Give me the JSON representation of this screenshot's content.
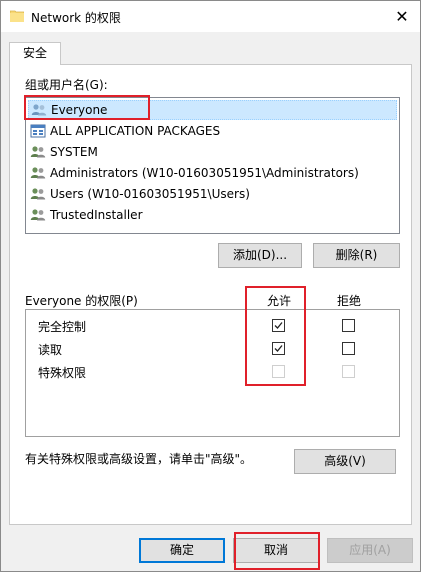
{
  "window": {
    "title": "Network 的权限",
    "close_glyph": "✕"
  },
  "tabs": [
    {
      "label": "安全"
    }
  ],
  "group": {
    "label": "组或用户名(G):",
    "items": [
      {
        "label": "Everyone",
        "icon": "users-icon",
        "selected": true
      },
      {
        "label": "ALL APPLICATION PACKAGES",
        "icon": "app-packages-icon"
      },
      {
        "label": "SYSTEM",
        "icon": "users-icon"
      },
      {
        "label": "Administrators (W10-01603051951\\Administrators)",
        "icon": "users-icon"
      },
      {
        "label": "Users (W10-01603051951\\Users)",
        "icon": "users-icon"
      },
      {
        "label": "TrustedInstaller",
        "icon": "users-icon"
      }
    ],
    "add_label": "添加(D)...",
    "remove_label": "删除(R)"
  },
  "permissions": {
    "title": "Everyone 的权限(P)",
    "allow_header": "允许",
    "deny_header": "拒绝",
    "rows": [
      {
        "label": "完全控制",
        "allow": true,
        "deny": false,
        "enabled": true
      },
      {
        "label": "读取",
        "allow": true,
        "deny": false,
        "enabled": true
      },
      {
        "label": "特殊权限",
        "allow": false,
        "deny": false,
        "enabled": false
      }
    ]
  },
  "advanced": {
    "note": "有关特殊权限或高级设置，请单击\"高级\"。",
    "button_label": "高级(V)"
  },
  "footer": {
    "ok_label": "确定",
    "cancel_label": "取消",
    "apply_label": "应用(A)"
  },
  "colors": {
    "highlight": "#e0202a",
    "selection": "#cce8ff",
    "accent": "#0078d7"
  }
}
